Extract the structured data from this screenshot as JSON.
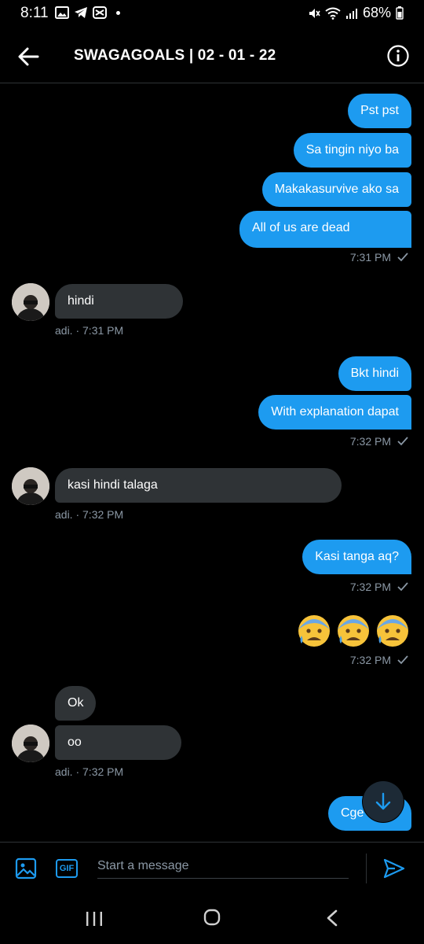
{
  "status_bar": {
    "time": "8:11",
    "battery": "68%"
  },
  "header": {
    "title": "SWAGAGOALS | 02 - 01 - 22"
  },
  "messages": [
    {
      "dir": "out",
      "text": "Pst pst"
    },
    {
      "dir": "out",
      "text": "Sa tingin niyo ba"
    },
    {
      "dir": "out",
      "text": "Makakasurvive ako sa"
    },
    {
      "dir": "out",
      "text": "All of us are dead"
    },
    {
      "dir": "in",
      "text": "hindi"
    },
    {
      "dir": "out",
      "text": "Bkt hindi"
    },
    {
      "dir": "out",
      "text": "With explanation dapat"
    },
    {
      "dir": "in",
      "text": "kasi hindi talaga"
    },
    {
      "dir": "out",
      "text": "Kasi tanga aq?"
    },
    {
      "dir": "out",
      "text": "😰😰😰"
    },
    {
      "dir": "in",
      "text": "Ok"
    },
    {
      "dir": "in",
      "text": "oo"
    },
    {
      "dir": "out",
      "text": "Cge"
    }
  ],
  "meta": {
    "out_1": "7:31 PM",
    "in_1": "adi. · 7:31 PM",
    "out_2": "7:32 PM",
    "in_2": "adi. · 7:32 PM",
    "out_3": "7:32 PM",
    "out_4": "7:32 PM",
    "in_3": "adi. · 7:32 PM"
  },
  "composer": {
    "placeholder": "Start a message",
    "gif_label": "GIF"
  },
  "colors": {
    "accent": "#1d9bf0",
    "incoming": "#2f3336",
    "background": "#000000",
    "muted": "#8b98a5"
  },
  "icons": [
    "back-arrow-icon",
    "info-icon",
    "image-icon",
    "gif-icon",
    "send-icon",
    "arrow-down-icon",
    "check-icon",
    "recents-icon",
    "home-icon",
    "nav-back-icon"
  ]
}
